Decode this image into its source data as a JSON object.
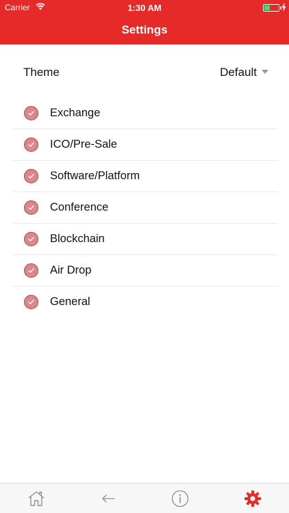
{
  "status_bar": {
    "carrier": "Carrier",
    "time": "1:30 AM",
    "battery_level_percent": 40
  },
  "navbar": {
    "title": "Settings"
  },
  "theme": {
    "label": "Theme",
    "selected": "Default"
  },
  "categories": [
    {
      "label": "Exchange",
      "checked": true
    },
    {
      "label": "ICO/Pre-Sale",
      "checked": true
    },
    {
      "label": "Software/Platform",
      "checked": true
    },
    {
      "label": "Conference",
      "checked": true
    },
    {
      "label": "Blockchain",
      "checked": true
    },
    {
      "label": "Air Drop",
      "checked": true
    },
    {
      "label": "General",
      "checked": true
    }
  ],
  "tabbar": {
    "items": [
      {
        "icon": "home-icon",
        "active": false
      },
      {
        "icon": "back-arrow-icon",
        "active": false
      },
      {
        "icon": "info-icon",
        "active": false
      },
      {
        "icon": "gear-icon",
        "active": true
      }
    ]
  },
  "colors": {
    "brand_red": "#e62a2a",
    "check_fill": "#d88a8a",
    "check_border": "#c83a3a",
    "tab_inactive": "#8e8e93",
    "tab_active": "#e62a2a",
    "battery_green": "#4cd964"
  }
}
